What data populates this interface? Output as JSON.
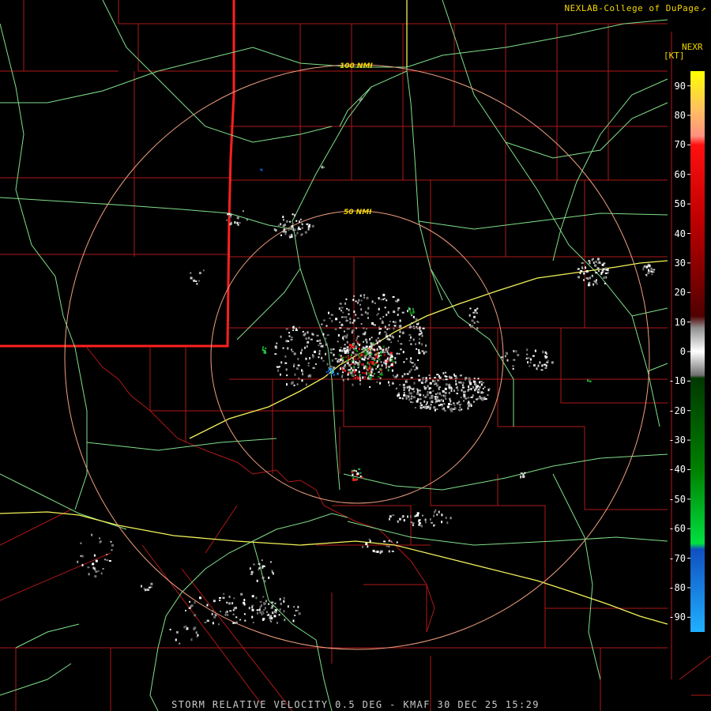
{
  "credit": "NEXLAB-College of DuPage",
  "credit_icon": "external-arrow-icon",
  "product_label": "NEXR",
  "unit_label": "[KT]",
  "status_bar": "STORM RELATIVE VELOCITY 0.5 DEG - KMAF 30 DEC 25 15:29",
  "rings": [
    {
      "label": "100 NMI"
    },
    {
      "label": "50 NMI"
    }
  ],
  "legend_ticks": [
    "90",
    "80",
    "70",
    "60",
    "50",
    "40",
    "30",
    "20",
    "10",
    "0",
    "-10",
    "-20",
    "-30",
    "-40",
    "-50",
    "-60",
    "-70",
    "-80",
    "-90"
  ],
  "colors": {
    "background": "#000000",
    "county_lines": "#b01818",
    "state_line": "#ff2020",
    "roads": "#7fe08a",
    "interstates": "#f2f25a",
    "range_rings": "#f0a080",
    "text": "#f2d600"
  },
  "colorbar": {
    "min": -95,
    "max": 95,
    "stops": [
      {
        "v": 95,
        "color": "#ffff00"
      },
      {
        "v": 82,
        "color": "#ffc060"
      },
      {
        "v": 73,
        "color": "#ff9080"
      },
      {
        "v": 70,
        "color": "#ff1010"
      },
      {
        "v": 45,
        "color": "#c00000"
      },
      {
        "v": 25,
        "color": "#800000"
      },
      {
        "v": 12,
        "color": "#500000"
      },
      {
        "v": 8,
        "color": "#909090"
      },
      {
        "v": 0,
        "color": "#ffffff"
      },
      {
        "v": -8,
        "color": "#707070"
      },
      {
        "v": -9,
        "color": "#003800"
      },
      {
        "v": -40,
        "color": "#008000"
      },
      {
        "v": -65,
        "color": "#00e040"
      },
      {
        "v": -67,
        "color": "#1050c0"
      },
      {
        "v": -95,
        "color": "#20b0ff"
      }
    ]
  }
}
